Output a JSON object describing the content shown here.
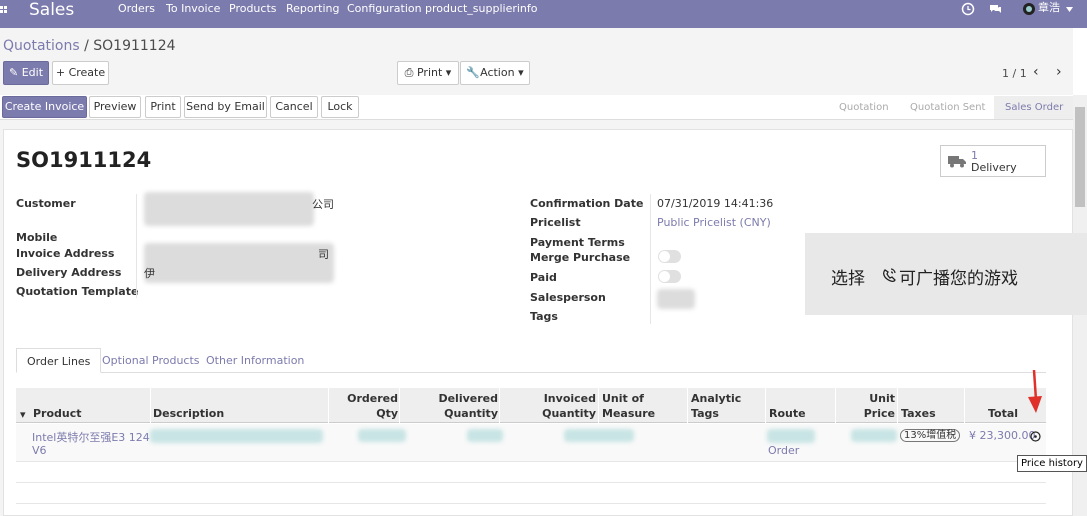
{
  "topbar": {
    "brand": "Sales",
    "menu": [
      "Orders",
      "To Invoice",
      "Products",
      "Reporting",
      "Configuration",
      "product_supplierinfo"
    ],
    "user": "章浩",
    "colors": {
      "navbar": "#7c7bad"
    }
  },
  "breadcrumb": {
    "parent": "Quotations",
    "sep": " / ",
    "current": "SO1911124"
  },
  "control": {
    "edit": "Edit",
    "create": "Create",
    "print": "Print",
    "action": "Action",
    "pager": "1 / 1"
  },
  "status_buttons": [
    "Create Invoice",
    "Preview",
    "Print",
    "Send by Email",
    "Cancel",
    "Lock"
  ],
  "stages": [
    "Quotation",
    "Quotation Sent",
    "Sales Order"
  ],
  "order": {
    "name": "SO1911124",
    "delivery_count": "1",
    "delivery_label": "Delivery"
  },
  "left_fields": {
    "customer": "Customer",
    "customer_suffix": "公司",
    "mobile": "Mobile",
    "invoice_address": "Invoice Address",
    "invoice_suffix": "司",
    "delivery_address": "Delivery Address",
    "delivery_prefix": "伊",
    "quotation_template": "Quotation Template"
  },
  "right_fields": {
    "confirmation_date": "Confirmation Date",
    "confirmation_value": "07/31/2019 14:41:36",
    "pricelist": "Pricelist",
    "pricelist_value": "Public Pricelist (CNY)",
    "payment_terms": "Payment Terms",
    "merge_purchase": "Merge Purchase",
    "paid": "Paid",
    "salesperson": "Salesperson",
    "tags": "Tags"
  },
  "overlay": {
    "text_before": "选择",
    "text_after": "可广播您的游戏"
  },
  "tabs": [
    "Order Lines",
    "Optional Products",
    "Other Information"
  ],
  "table": {
    "headers": {
      "product": "Product",
      "description": "Description",
      "ordered_qty": [
        "Ordered",
        "Qty"
      ],
      "delivered_qty": [
        "Delivered",
        "Quantity"
      ],
      "invoiced_qty": [
        "Invoiced",
        "Quantity"
      ],
      "uom": [
        "Unit of",
        "Measure"
      ],
      "analytic_tags": [
        "Analytic",
        "Tags"
      ],
      "route": "Route",
      "unit_price": [
        "Unit",
        "Price"
      ],
      "taxes": "Taxes",
      "total": "Total"
    },
    "row": {
      "product_line1": "Intel英特尔至强E3 124",
      "product_line2": "V6",
      "route_suffix": "Order",
      "tax": "13%增值税",
      "total": "¥ 23,300.00"
    }
  },
  "tooltip": "Price history"
}
